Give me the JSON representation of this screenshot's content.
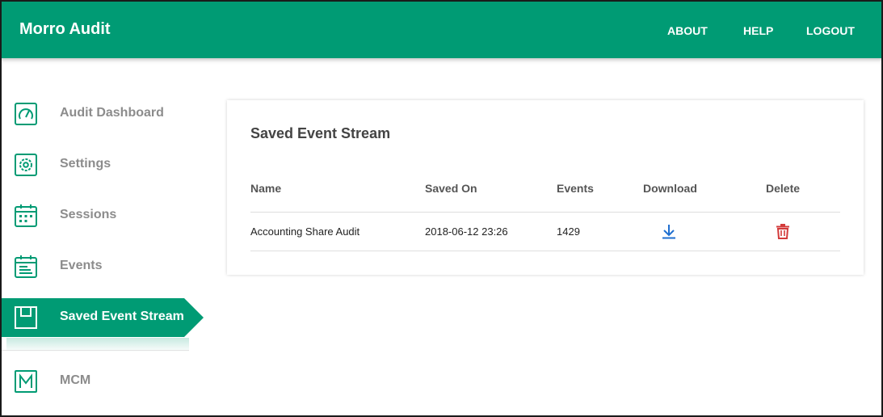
{
  "app": {
    "title": "Morro Audit"
  },
  "nav": {
    "about": "ABOUT",
    "help": "HELP",
    "logout": "LOGOUT"
  },
  "colors": {
    "brand": "#009b74",
    "delete": "#d33b3b",
    "download": "#1f6fd0"
  },
  "sidebar": {
    "items": [
      {
        "label": "Audit Dashboard",
        "icon": "gauge-icon"
      },
      {
        "label": "Settings",
        "icon": "gear-icon"
      },
      {
        "label": "Sessions",
        "icon": "calendar-grid-icon"
      },
      {
        "label": "Events",
        "icon": "calendar-list-icon"
      },
      {
        "label": "Saved Event Stream",
        "icon": "save-icon",
        "active": true
      },
      {
        "label": "MCM",
        "icon": "m-letter-icon"
      }
    ]
  },
  "main": {
    "card_title": "Saved Event Stream",
    "columns": [
      "Name",
      "Saved On",
      "Events",
      "Download",
      "Delete"
    ],
    "rows": [
      {
        "name": "Accounting Share Audit",
        "saved_on": "2018-06-12 23:26",
        "events": "1429",
        "download_icon": "download-icon",
        "delete_icon": "trash-icon"
      }
    ]
  }
}
